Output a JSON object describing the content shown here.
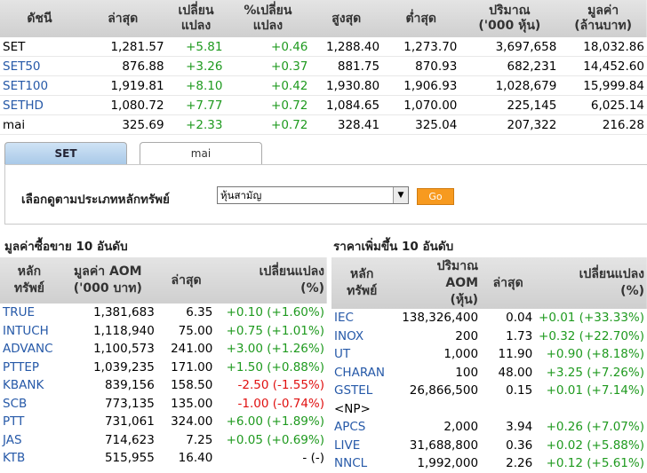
{
  "index_table": {
    "headers": [
      "ดัชนี",
      "ล่าสุด",
      "เปลี่ยน\nแปลง",
      "%เปลี่ยน\nแปลง",
      "สูงสุด",
      "ต่ำสุด",
      "ปริมาณ\n('000 หุ้น)",
      "มูลค่า\n(ล้านบาท)"
    ],
    "rows": [
      {
        "name": "SET",
        "last": "1,281.57",
        "chg": "+5.81",
        "pct": "+0.46",
        "high": "1,288.40",
        "low": "1,273.70",
        "vol": "3,697,658",
        "val": "18,032.86",
        "link": false
      },
      {
        "name": "SET50",
        "last": "876.88",
        "chg": "+3.26",
        "pct": "+0.37",
        "high": "881.75",
        "low": "870.93",
        "vol": "682,231",
        "val": "14,452.60",
        "link": true
      },
      {
        "name": "SET100",
        "last": "1,919.81",
        "chg": "+8.10",
        "pct": "+0.42",
        "high": "1,930.80",
        "low": "1,906.93",
        "vol": "1,028,679",
        "val": "15,999.84",
        "link": true
      },
      {
        "name": "SETHD",
        "last": "1,080.72",
        "chg": "+7.77",
        "pct": "+0.72",
        "high": "1,084.65",
        "low": "1,070.00",
        "vol": "225,145",
        "val": "6,025.14",
        "link": true
      },
      {
        "name": "mai",
        "last": "325.69",
        "chg": "+2.33",
        "pct": "+0.72",
        "high": "328.41",
        "low": "325.04",
        "vol": "207,322",
        "val": "216.28",
        "link": false
      }
    ]
  },
  "tabs": [
    {
      "label": "SET",
      "active": true
    },
    {
      "label": "mai",
      "active": false
    }
  ],
  "filter": {
    "label": "เลือกดูตามประเภทหลักทรัพย์",
    "selected": "หุ้นสามัญ",
    "go": "Go"
  },
  "left_section": {
    "title": "มูลค่าซื้อขาย 10 อันดับ",
    "headers": [
      "หลัก\nทรัพย์",
      "มูลค่า AOM\n('000 บาท)",
      "ล่าสุด",
      "เปลี่ยนแปลง\n(%)"
    ],
    "rows": [
      {
        "sym": "TRUE",
        "val": "1,381,683",
        "last": "6.35",
        "chg": "+0.10 (+1.60%)",
        "dir": "pos"
      },
      {
        "sym": "INTUCH",
        "val": "1,118,940",
        "last": "75.00",
        "chg": "+0.75 (+1.01%)",
        "dir": "pos"
      },
      {
        "sym": "ADVANC",
        "val": "1,100,573",
        "last": "241.00",
        "chg": "+3.00 (+1.26%)",
        "dir": "pos"
      },
      {
        "sym": "PTTEP",
        "val": "1,039,235",
        "last": "171.00",
        "chg": "+1.50 (+0.88%)",
        "dir": "pos"
      },
      {
        "sym": "KBANK",
        "val": "839,156",
        "last": "158.50",
        "chg": "-2.50 (-1.55%)",
        "dir": "neg"
      },
      {
        "sym": "SCB",
        "val": "773,135",
        "last": "135.00",
        "chg": "-1.00 (-0.74%)",
        "dir": "neg"
      },
      {
        "sym": "PTT",
        "val": "731,061",
        "last": "324.00",
        "chg": "+6.00 (+1.89%)",
        "dir": "pos"
      },
      {
        "sym": "JAS",
        "val": "714,623",
        "last": "7.25",
        "chg": "+0.05 (+0.69%)",
        "dir": "pos"
      },
      {
        "sym": "KTB",
        "val": "515,955",
        "last": "16.40",
        "chg": "- (-)",
        "dir": "neu"
      }
    ]
  },
  "right_section": {
    "title": "ราคาเพิ่มขึ้น 10 อันดับ",
    "headers": [
      "หลัก\nทรัพย์",
      "ปริมาณ\nAOM\n(หุ้น)",
      "ล่าสุด",
      "เปลี่ยนแปลง\n(%)"
    ],
    "rows": [
      {
        "sym": "IEC",
        "vol": "138,326,400",
        "last": "0.04",
        "chg": "+0.01 (+33.33%)"
      },
      {
        "sym": "INOX",
        "vol": "200",
        "last": "1.73",
        "chg": "+0.32 (+22.70%)"
      },
      {
        "sym": "UT",
        "vol": "1,000",
        "last": "11.90",
        "chg": "+0.90 (+8.18%)"
      },
      {
        "sym": "CHARAN",
        "vol": "100",
        "last": "48.00",
        "chg": "+3.25 (+7.26%)"
      },
      {
        "sym": "GSTEL",
        "vol": "26,866,500",
        "last": "0.15",
        "chg": "+0.01 (+7.14%)"
      },
      {
        "sym": "<NP>",
        "vol": "",
        "last": "",
        "chg": "",
        "plain": true
      },
      {
        "sym": "APCS",
        "vol": "2,000",
        "last": "3.94",
        "chg": "+0.26 (+7.07%)"
      },
      {
        "sym": "LIVE",
        "vol": "31,688,800",
        "last": "0.36",
        "chg": "+0.02 (+5.88%)"
      },
      {
        "sym": "NNCL",
        "vol": "1,992,000",
        "last": "2.26",
        "chg": "+0.12 (+5.61%)"
      }
    ]
  },
  "colors": {
    "positive": "#1f9a1f",
    "negative": "#e01010",
    "link": "#2659a8",
    "go_button": "#f79a1f"
  }
}
